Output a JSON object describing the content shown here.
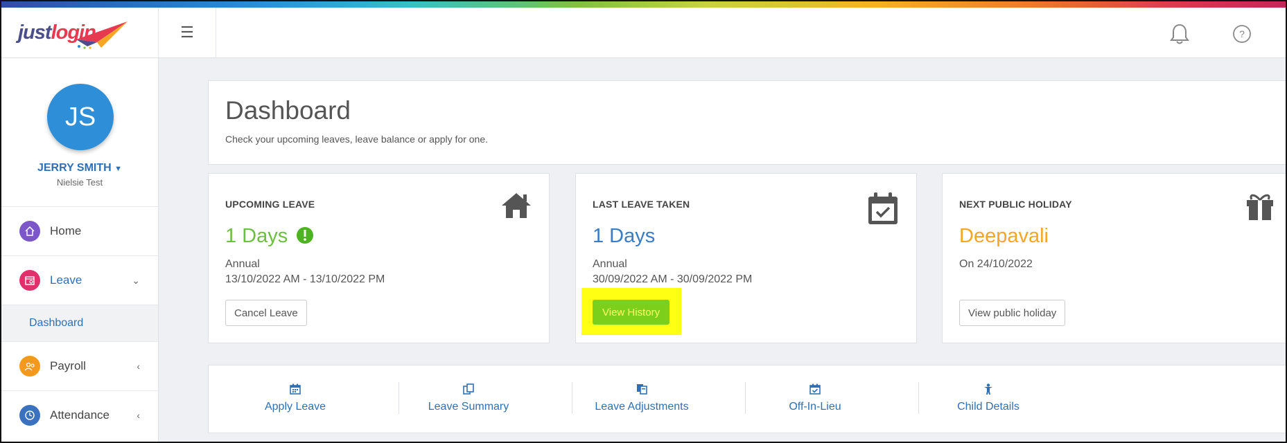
{
  "app": {
    "logo_text_a": "just",
    "logo_text_b": "login"
  },
  "topbar": {
    "menu_icon": "hamburger-icon",
    "notification_icon": "bell-icon",
    "help_icon": "question-icon"
  },
  "user": {
    "initials": "JS",
    "name": "JERRY SMITH",
    "company": "Nielsie Test"
  },
  "sidebar": {
    "items": [
      {
        "label": "Home",
        "icon": "home-icon",
        "color": "#7b57c9"
      },
      {
        "label": "Leave",
        "icon": "leave-icon",
        "color": "#e2306c",
        "chevron": "⌄"
      },
      {
        "label": "Payroll",
        "icon": "payroll-icon",
        "color": "#f39a1e",
        "chevron": "‹"
      },
      {
        "label": "Attendance",
        "icon": "clock-icon",
        "color": "#3a72c0",
        "chevron": "‹"
      }
    ],
    "sub_item": "Dashboard"
  },
  "header": {
    "title": "Dashboard",
    "subtitle": "Check your upcoming leaves, leave balance or apply for one."
  },
  "cards": {
    "upcoming": {
      "caption": "UPCOMING LEAVE",
      "value": "1 Days",
      "type": "Annual",
      "dates": "13/10/2022 AM - 13/10/2022 PM",
      "button": "Cancel Leave"
    },
    "last": {
      "caption": "LAST LEAVE TAKEN",
      "value": "1 Days",
      "type": "Annual",
      "dates": "30/09/2022 AM - 30/09/2022 PM",
      "button": "View History"
    },
    "holiday": {
      "caption": "NEXT PUBLIC HOLIDAY",
      "value": "Deepavali",
      "date": "On 24/10/2022",
      "button": "View public holiday"
    }
  },
  "quick_links": [
    {
      "label": "Apply Leave",
      "icon": "calendar-icon"
    },
    {
      "label": "Leave Summary",
      "icon": "copy-icon"
    },
    {
      "label": "Leave Adjustments",
      "icon": "files-icon"
    },
    {
      "label": "Off-In-Lieu",
      "icon": "calendar-check-icon"
    },
    {
      "label": "Child Details",
      "icon": "child-icon"
    }
  ],
  "colors": {
    "accent_blue": "#2f6fb3",
    "upcoming_green": "#6cbf3f",
    "last_blue": "#3a7dc4",
    "holiday_orange": "#f5a623",
    "highlight_yellow": "#ffff14",
    "history_green": "#7ccf1a"
  }
}
